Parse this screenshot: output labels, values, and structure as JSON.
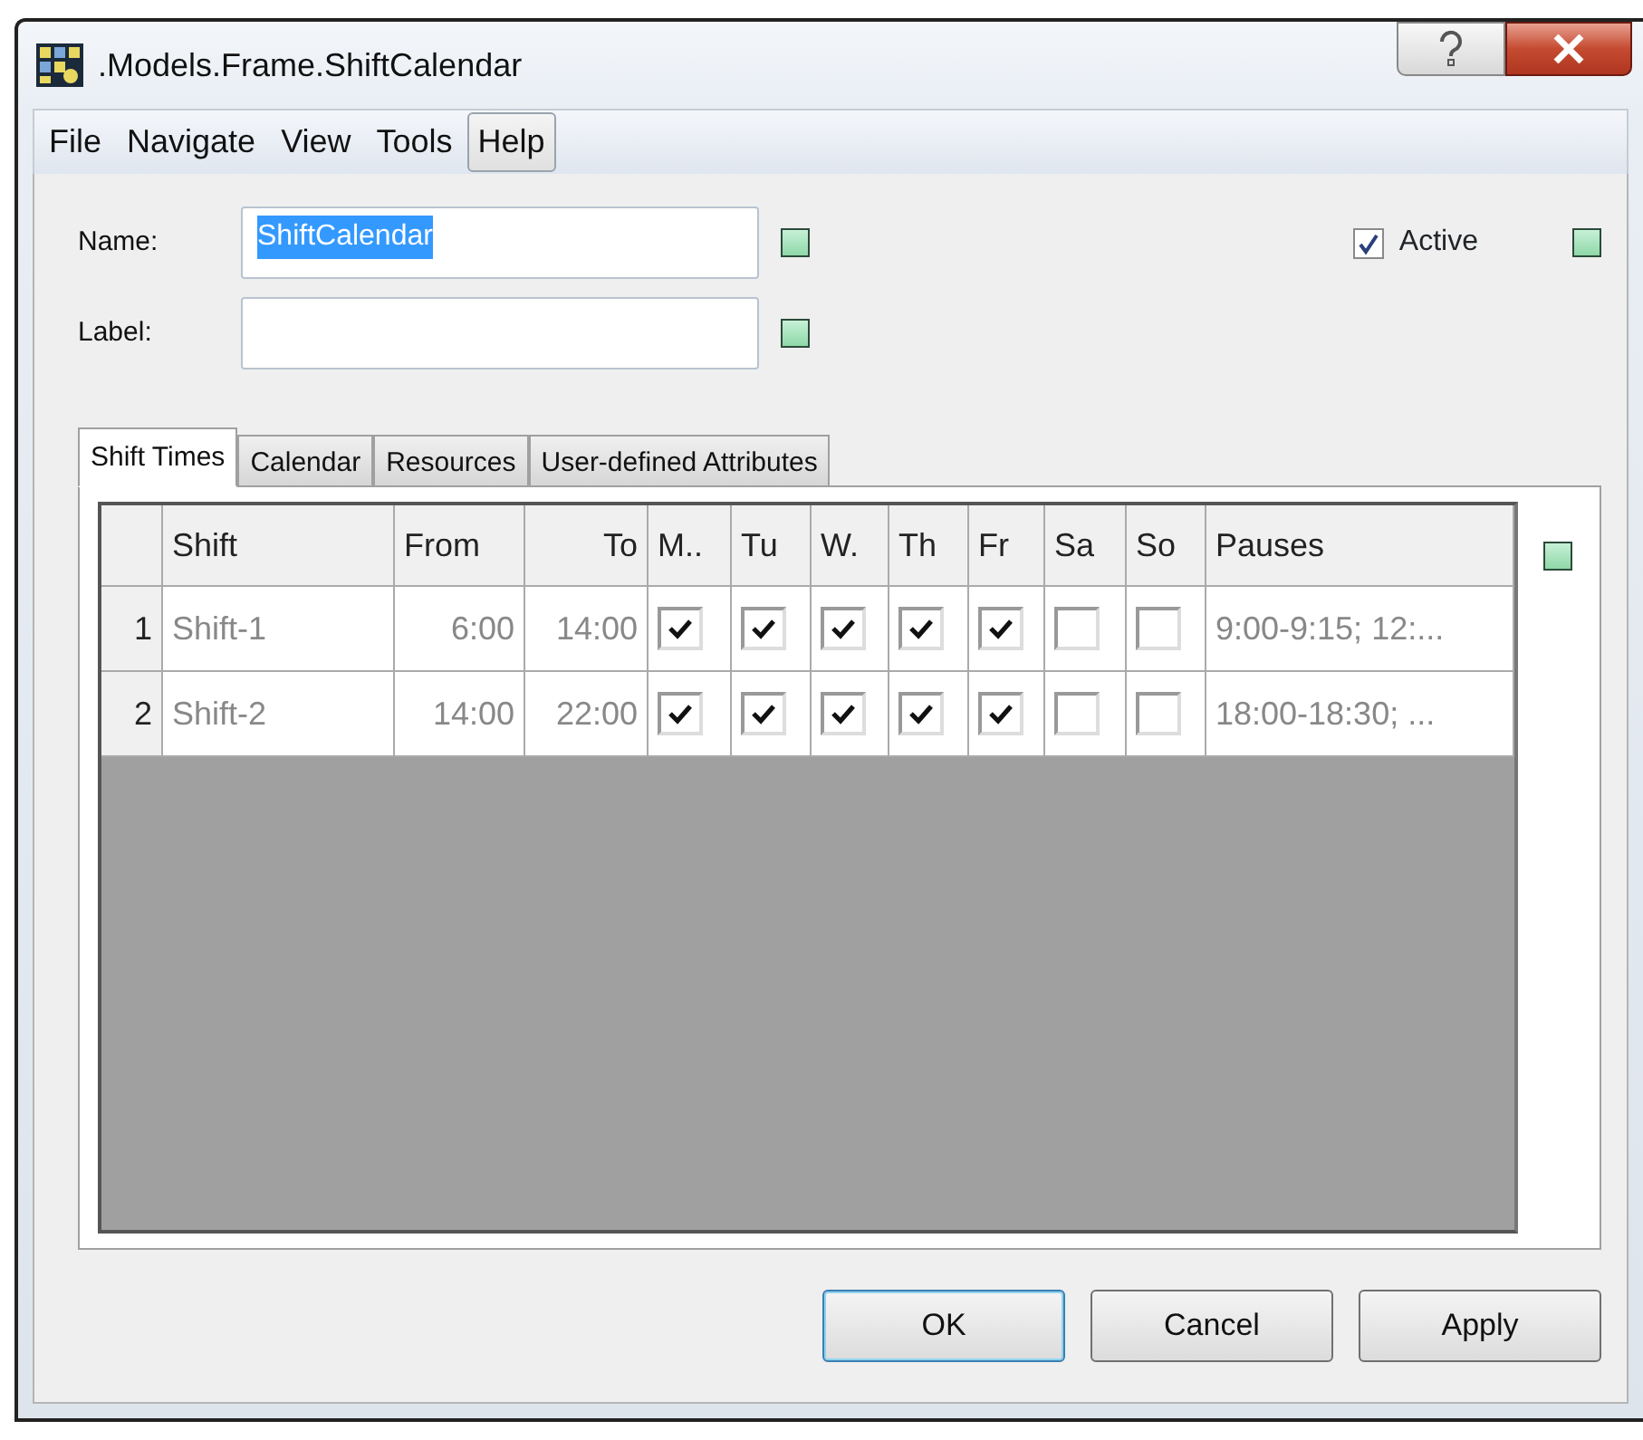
{
  "window": {
    "title": ".Models.Frame.ShiftCalendar"
  },
  "menu": [
    {
      "label": "File",
      "highlighted": false
    },
    {
      "label": "Navigate",
      "highlighted": false
    },
    {
      "label": "View",
      "highlighted": false
    },
    {
      "label": "Tools",
      "highlighted": false
    },
    {
      "label": "Help",
      "highlighted": true
    }
  ],
  "fields": [
    {
      "label": "Name:",
      "value": "ShiftCalendar",
      "value_selected": true
    },
    {
      "label": "Label:"
    }
  ],
  "active": {
    "label": "Active",
    "checked": true
  },
  "tabs": [
    {
      "label": "Shift Times",
      "selected": true
    },
    {
      "label": "Calendar",
      "selected": false
    },
    {
      "label": "Resources",
      "selected": false
    },
    {
      "label": "User-defined Attributes",
      "selected": false
    }
  ],
  "table": {
    "columns": [
      {
        "label": "Shift",
        "kind": "text"
      },
      {
        "label": "From",
        "kind": "time"
      },
      {
        "label": "To",
        "kind": "time"
      },
      {
        "label": "M..",
        "kind": "check"
      },
      {
        "label": "Tu",
        "kind": "check"
      },
      {
        "label": "W.",
        "kind": "check"
      },
      {
        "label": "Th",
        "kind": "check"
      },
      {
        "label": "Fr",
        "kind": "check"
      },
      {
        "label": "Sa",
        "kind": "check"
      },
      {
        "label": "So",
        "kind": "check"
      },
      {
        "label": "Pauses",
        "kind": "text"
      }
    ],
    "rows": [
      {
        "number": "1",
        "cells": [
          "Shift-1",
          "6:00",
          "14:00",
          true,
          true,
          true,
          true,
          true,
          false,
          false,
          "9:00-9:15; 12:..."
        ]
      },
      {
        "number": "2",
        "cells": [
          "Shift-2",
          "14:00",
          "22:00",
          true,
          true,
          true,
          true,
          true,
          false,
          false,
          "18:00-18:30; ..."
        ]
      }
    ]
  },
  "buttons": [
    {
      "label": "OK",
      "default": true
    },
    {
      "label": "Cancel",
      "default": false
    },
    {
      "label": "Apply",
      "default": false
    }
  ]
}
